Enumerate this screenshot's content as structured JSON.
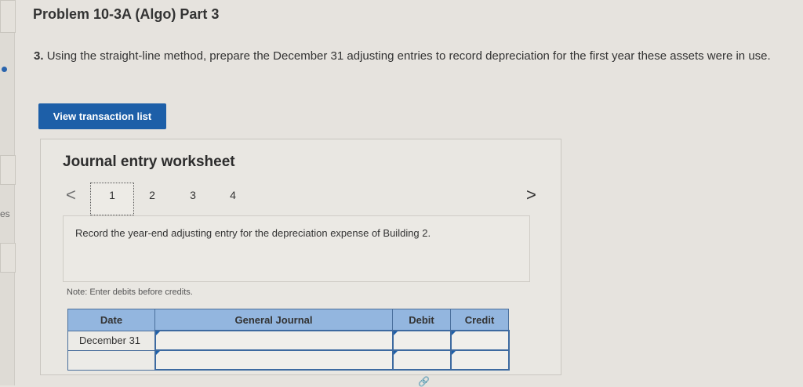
{
  "sidebar": {
    "partial_text": "es"
  },
  "header": {
    "title": "Problem 10-3A (Algo) Part 3"
  },
  "question": {
    "number": "3.",
    "text": "Using the straight-line method, prepare the December 31 adjusting entries to record depreciation for the first year these assets were in use."
  },
  "actions": {
    "view_transactions_label": "View transaction list"
  },
  "worksheet": {
    "title": "Journal entry worksheet",
    "pages": [
      "1",
      "2",
      "3",
      "4"
    ],
    "prev_icon": "<",
    "next_icon": ">",
    "description": "Record the year-end adjusting entry for the depreciation expense of Building 2.",
    "note": "Note: Enter debits before credits."
  },
  "journal": {
    "headers": {
      "date": "Date",
      "general_journal": "General Journal",
      "debit": "Debit",
      "credit": "Credit"
    },
    "rows": [
      {
        "date": "December 31",
        "account": "",
        "debit": "",
        "credit": ""
      },
      {
        "date": "",
        "account": "",
        "debit": "",
        "credit": ""
      }
    ]
  }
}
